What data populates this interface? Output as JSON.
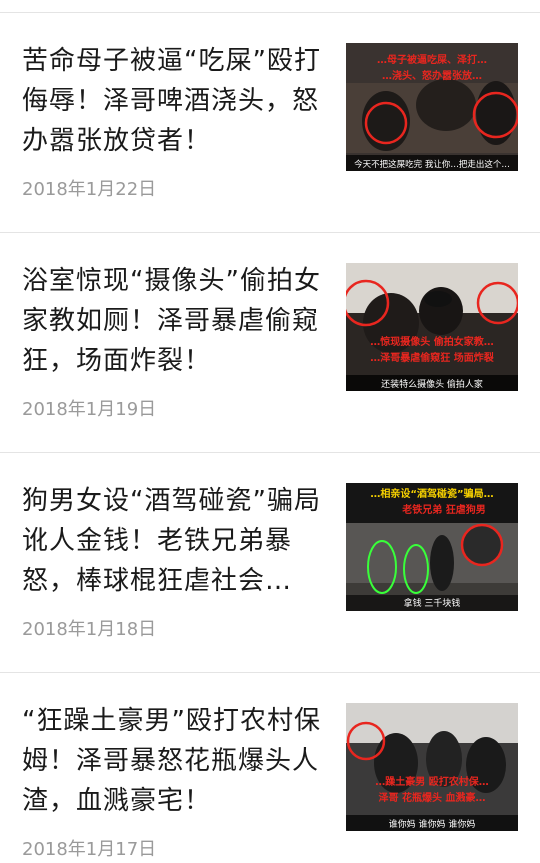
{
  "articles": [
    {
      "title": "苦命母子被逼“吃屎”殴打侮辱！泽哥啤酒浇头，怒办嚣张放贷者！",
      "date": "2018年1月22日",
      "thumb": {
        "overlay_line1": "…母子被逼吃屎、泽打…",
        "overlay_line2": "…浇头、怒办嚣张放…",
        "caption": "今天不把这屎吃完 我让你…把走出这个…",
        "accent": "#e8261f"
      }
    },
    {
      "title": "浴室惊现“摄像头”偷拍女家教如厕！泽哥暴虐偷窥狂，场面炸裂！",
      "date": "2018年1月19日",
      "thumb": {
        "overlay_line1": "…惊现摄像头 偷拍女家教…",
        "overlay_line2": "…泽哥暴虐偷窥狂 场面炸裂",
        "caption": "还装特么摄像头 偷拍人家",
        "accent": "#e8261f"
      }
    },
    {
      "title": "狗男女设“酒驾碰瓷”骗局讹人金钱！老铁兄弟暴怒，棒球棍狂虐社会…",
      "date": "2018年1月18日",
      "thumb": {
        "overlay_line1": "…相亲设“酒驾碰瓷”骗局…",
        "overlay_line2": "老铁兄弟 狂虐狗男",
        "caption": "拿钱 三千块钱",
        "accent": "#f5d000"
      }
    },
    {
      "title": "“狂躁土豪男”殴打农村保姆！泽哥暴怒花瓶爆头人渣，血溅豪宅！",
      "date": "2018年1月17日",
      "thumb": {
        "overlay_line1": "…躁土豪男 殴打农村保…",
        "overlay_line2": "泽哥 花瓶爆头 血溅豪…",
        "caption": "谁你妈 谁你妈 谁你妈",
        "accent": "#e8261f"
      }
    }
  ]
}
